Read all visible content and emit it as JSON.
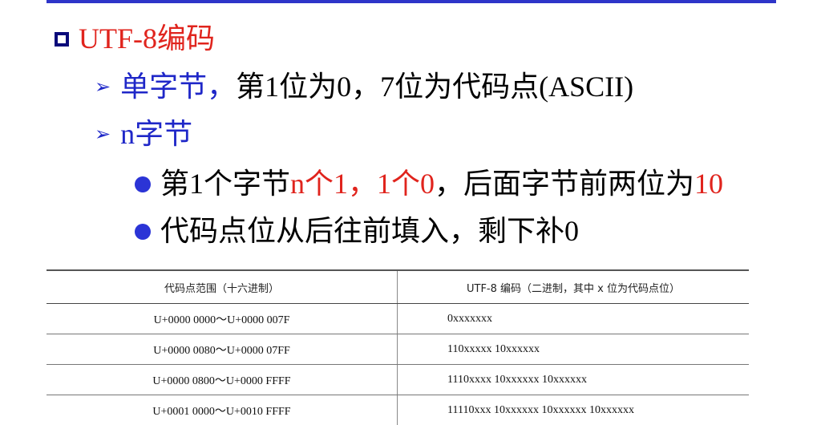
{
  "colors": {
    "accent_blue": "#1f27c8",
    "red": "#e0241d",
    "rule": "#2e35c9"
  },
  "heading": {
    "icon": "square-bullet-icon",
    "text": "UTF-8编码"
  },
  "bullets": [
    {
      "icon": "arrow-bullet-icon",
      "segments": [
        "单字节，",
        "第1位为0，7位为代码点(ASCII)"
      ]
    },
    {
      "icon": "arrow-bullet-icon",
      "segments": [
        "n字节"
      ]
    }
  ],
  "sub_bullets": [
    {
      "icon": "dot-bullet-icon",
      "segments": [
        "第1个字节",
        "n个1，1个0",
        "，后面字节前两位为",
        "10"
      ]
    },
    {
      "icon": "dot-bullet-icon",
      "segments": [
        "代码点位从后往前填入，剩下补0"
      ]
    }
  ],
  "table": {
    "headers": [
      "代码点范围（十六进制）",
      "UTF-8 编码（二进制，其中 x 位为代码点位）"
    ],
    "rows": [
      [
        "U+0000 0000～U+0000 007F",
        "0xxxxxxx"
      ],
      [
        "U+0000 0080～U+0000 07FF",
        "110xxxxx 10xxxxxx"
      ],
      [
        "U+0000 0800～U+0000 FFFF",
        "1110xxxx 10xxxxxx 10xxxxxx"
      ],
      [
        "U+0001 0000～U+0010 FFFF",
        "11110xxx 10xxxxxx 10xxxxxx 10xxxxxx"
      ]
    ]
  }
}
